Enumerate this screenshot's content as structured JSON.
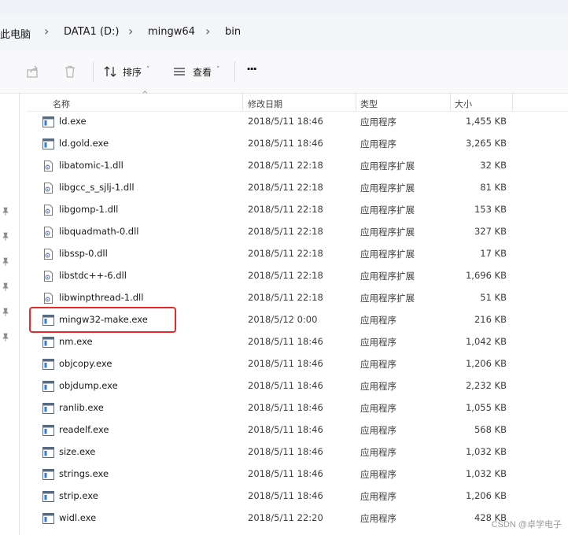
{
  "breadcrumb": {
    "items": [
      "此电脑",
      "DATA1 (D:)",
      "mingw64",
      "bin"
    ],
    "separator": "›"
  },
  "toolbar": {
    "sort_label": "排序",
    "view_label": "查看",
    "more_label": "···",
    "chevron": "˅"
  },
  "columns": {
    "name": "名称",
    "date": "修改日期",
    "type": "类型",
    "size": "大小",
    "sort_caret": "^"
  },
  "files": [
    {
      "name": "ld.exe",
      "date": "2018/5/11 18:46",
      "type": "应用程序",
      "size": "1,455 KB",
      "kind": "exe"
    },
    {
      "name": "ld.gold.exe",
      "date": "2018/5/11 18:46",
      "type": "应用程序",
      "size": "3,265 KB",
      "kind": "exe"
    },
    {
      "name": "libatomic-1.dll",
      "date": "2018/5/11 22:18",
      "type": "应用程序扩展",
      "size": "32 KB",
      "kind": "dll"
    },
    {
      "name": "libgcc_s_sjlj-1.dll",
      "date": "2018/5/11 22:18",
      "type": "应用程序扩展",
      "size": "81 KB",
      "kind": "dll"
    },
    {
      "name": "libgomp-1.dll",
      "date": "2018/5/11 22:18",
      "type": "应用程序扩展",
      "size": "153 KB",
      "kind": "dll"
    },
    {
      "name": "libquadmath-0.dll",
      "date": "2018/5/11 22:18",
      "type": "应用程序扩展",
      "size": "327 KB",
      "kind": "dll"
    },
    {
      "name": "libssp-0.dll",
      "date": "2018/5/11 22:18",
      "type": "应用程序扩展",
      "size": "17 KB",
      "kind": "dll"
    },
    {
      "name": "libstdc++-6.dll",
      "date": "2018/5/11 22:18",
      "type": "应用程序扩展",
      "size": "1,696 KB",
      "kind": "dll"
    },
    {
      "name": "libwinpthread-1.dll",
      "date": "2018/5/11 22:18",
      "type": "应用程序扩展",
      "size": "51 KB",
      "kind": "dll"
    },
    {
      "name": "mingw32-make.exe",
      "date": "2018/5/12 0:00",
      "type": "应用程序",
      "size": "216 KB",
      "kind": "exe"
    },
    {
      "name": "nm.exe",
      "date": "2018/5/11 18:46",
      "type": "应用程序",
      "size": "1,042 KB",
      "kind": "exe"
    },
    {
      "name": "objcopy.exe",
      "date": "2018/5/11 18:46",
      "type": "应用程序",
      "size": "1,206 KB",
      "kind": "exe"
    },
    {
      "name": "objdump.exe",
      "date": "2018/5/11 18:46",
      "type": "应用程序",
      "size": "2,232 KB",
      "kind": "exe"
    },
    {
      "name": "ranlib.exe",
      "date": "2018/5/11 18:46",
      "type": "应用程序",
      "size": "1,055 KB",
      "kind": "exe"
    },
    {
      "name": "readelf.exe",
      "date": "2018/5/11 18:46",
      "type": "应用程序",
      "size": "568 KB",
      "kind": "exe"
    },
    {
      "name": "size.exe",
      "date": "2018/5/11 18:46",
      "type": "应用程序",
      "size": "1,032 KB",
      "kind": "exe"
    },
    {
      "name": "strings.exe",
      "date": "2018/5/11 18:46",
      "type": "应用程序",
      "size": "1,032 KB",
      "kind": "exe"
    },
    {
      "name": "strip.exe",
      "date": "2018/5/11 18:46",
      "type": "应用程序",
      "size": "1,206 KB",
      "kind": "exe"
    },
    {
      "name": "widl.exe",
      "date": "2018/5/11 22:20",
      "type": "应用程序",
      "size": "428 KB",
      "kind": "exe"
    }
  ],
  "highlight_color": "#e52a2a",
  "watermark": "CSDN @卓学电子"
}
